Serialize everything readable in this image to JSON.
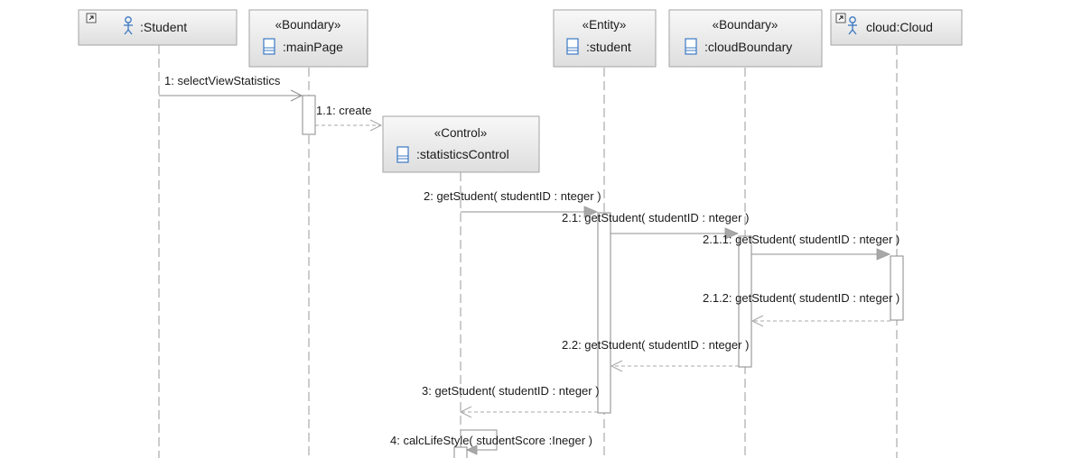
{
  "diagram": {
    "lifelines": [
      {
        "id": "student-actor",
        "stereotype": "",
        "name": ":Student",
        "icon": "actor-icon"
      },
      {
        "id": "mainpage",
        "stereotype": "«Boundary»",
        "name": ":mainPage",
        "icon": "boundary-icon"
      },
      {
        "id": "statistics-control",
        "stereotype": "«Control»",
        "name": ":statisticsControl",
        "icon": "control-icon"
      },
      {
        "id": "student-entity",
        "stereotype": "«Entity»",
        "name": ":student",
        "icon": "entity-icon"
      },
      {
        "id": "cloud-boundary",
        "stereotype": "«Boundary»",
        "name": ":cloudBoundary",
        "icon": "boundary-icon"
      },
      {
        "id": "cloud",
        "stereotype": "",
        "name": "cloud:Cloud",
        "icon": "actor-icon"
      }
    ],
    "messages": [
      {
        "id": "m1",
        "label": "1: selectViewStatistics",
        "kind": "call"
      },
      {
        "id": "m11",
        "label": "1.1: create",
        "kind": "create"
      },
      {
        "id": "m2",
        "label": "2: getStudent( studentID : nteger )",
        "kind": "call"
      },
      {
        "id": "m21",
        "label": "2.1: getStudent( studentID : nteger )",
        "kind": "call"
      },
      {
        "id": "m211",
        "label": "2.1.1: getStudent( studentID : nteger )",
        "kind": "call"
      },
      {
        "id": "m212",
        "label": "2.1.2: getStudent( studentID : nteger )",
        "kind": "reply"
      },
      {
        "id": "m22",
        "label": "2.2: getStudent( studentID : nteger )",
        "kind": "reply"
      },
      {
        "id": "m3",
        "label": "3: getStudent( studentID : nteger )",
        "kind": "reply"
      },
      {
        "id": "m4",
        "label": "4: calcLifeStyle( studentScore :Ineger )",
        "kind": "self"
      }
    ],
    "colors": {
      "box_top": "#f7f7f7",
      "box_bottom": "#dcdcdc",
      "icon_blue": "#3b78c3",
      "line": "#9a9a9a"
    }
  }
}
